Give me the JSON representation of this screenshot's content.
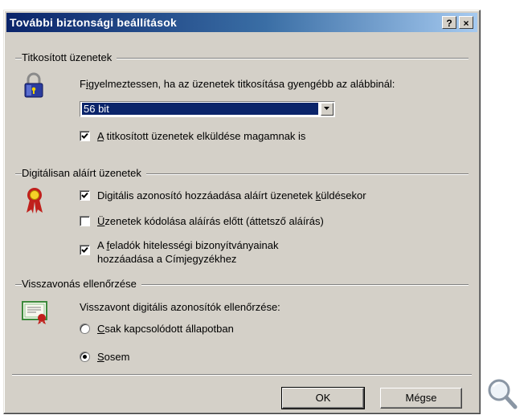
{
  "window": {
    "title": "További biztonsági beállítások",
    "help_label": "?",
    "close_label": "×"
  },
  "encrypted": {
    "group_label": "Titkosított üzenetek",
    "warn_prefix": "F",
    "warn_access": "i",
    "warn_rest": "gyelmeztessen, ha az üzenetek titkosítása gyengébb az alábbinál:",
    "strength_value": "56 bit",
    "send_to_self": {
      "access": "A",
      "rest": " titkosított üzenetek elküldése magamnak is",
      "checked": true
    }
  },
  "signed": {
    "group_label": "Digitálisan aláírt üzenetek",
    "add_id": {
      "before": "Digitális azonosító hozzáadása aláírt üzenetek ",
      "access": "k",
      "after": "üldésekor",
      "checked": true
    },
    "encode": {
      "access": "Ü",
      "rest": "zenetek kódolása aláírás előtt (áttetsző aláírás)",
      "checked": false
    },
    "add_certs": {
      "line1_prefix": "A ",
      "line1_access": "f",
      "line1_rest": "eladók hitelességi bizonyítványainak",
      "line2": "hozzáadása a Címjegyzékhez",
      "checked": true
    }
  },
  "revocation": {
    "group_label": "Visszavonás ellenőrzése",
    "description": "Visszavont digitális azonosítók ellenőrzése:",
    "online_only": {
      "access": "C",
      "rest": "sak kapcsolódott állapotban",
      "selected": false
    },
    "never": {
      "access": "S",
      "rest": "osem",
      "selected": true
    }
  },
  "buttons": {
    "ok": "OK",
    "cancel": "Mégse"
  },
  "icons": [
    "padlock-icon",
    "award-ribbon-icon",
    "certificate-icon",
    "magnifier-icon"
  ],
  "colors": {
    "face": "#d4d0c8",
    "title_start": "#0a246a",
    "title_end": "#a6caf0",
    "selection": "#0a246a"
  }
}
